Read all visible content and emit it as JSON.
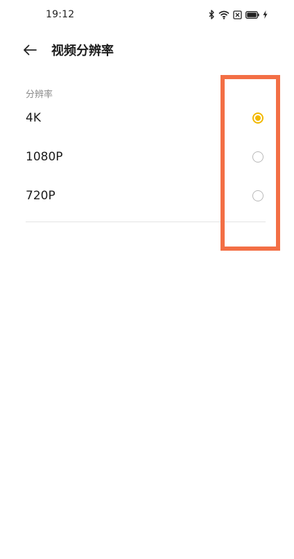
{
  "status_bar": {
    "time": "19:12",
    "icons": [
      "bluetooth-icon",
      "wifi-icon",
      "sim-close-icon",
      "battery-icon",
      "charging-icon"
    ]
  },
  "header": {
    "back_icon": "back-arrow-icon",
    "title": "视频分辨率"
  },
  "section": {
    "label": "分辨率",
    "options": [
      {
        "label": "4K",
        "selected": true
      },
      {
        "label": "1080P",
        "selected": false
      },
      {
        "label": "720P",
        "selected": false
      }
    ]
  },
  "colors": {
    "accent": "#f2b800",
    "highlight": "#f36f45",
    "radio_unchecked": "#b8b8b8",
    "divider": "#e3e3e3"
  }
}
